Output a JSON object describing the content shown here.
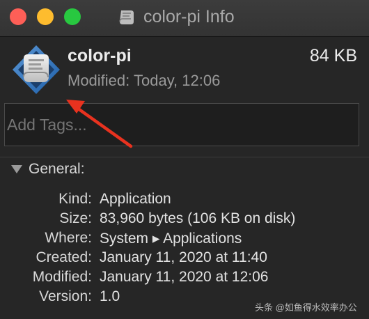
{
  "window": {
    "title": "color-pi Info"
  },
  "summary": {
    "name": "color-pi",
    "size": "84 KB",
    "modified": "Modified: Today, 12:06"
  },
  "tags": {
    "placeholder": "Add Tags..."
  },
  "general": {
    "header": "General:",
    "rows": [
      {
        "label": "Kind:",
        "value": "Application"
      },
      {
        "label": "Size:",
        "value": "83,960 bytes (106 KB on disk)"
      },
      {
        "label": "Where:",
        "value": "System ▸ Applications"
      },
      {
        "label": "Created:",
        "value": "January 11, 2020 at 11:40"
      },
      {
        "label": "Modified:",
        "value": "January 11, 2020 at 12:06"
      },
      {
        "label": "Version:",
        "value": "1.0"
      }
    ]
  },
  "watermark": "头条 @如鱼得水效率办公",
  "colors": {
    "annotation_arrow": "#e8321f",
    "close": "#fe5f57",
    "minimize": "#febc2e",
    "zoom": "#28c840"
  },
  "icons": [
    "script-app-icon"
  ]
}
